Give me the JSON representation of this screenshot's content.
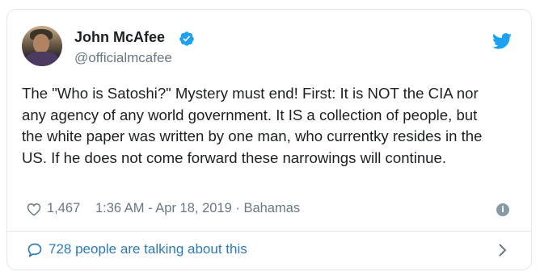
{
  "author": {
    "name": "John McAfee",
    "handle": "@officialmcafee",
    "verified": true
  },
  "tweet": {
    "text": "The \"Who is Satoshi?\" Mystery must end! First: It is NOT the CIA nor any agency of any world government. It IS a collection of people, but the white paper was written by one man, who currentky resides in the US. If he does not come forward these narrowings will continue."
  },
  "meta": {
    "likes": "1,467",
    "timestamp": "1:36 AM - Apr 18, 2019 · Bahamas"
  },
  "footer": {
    "conversation_label": "728 people are talking about this"
  },
  "colors": {
    "twitter_blue": "#1da1f2",
    "link_blue": "#2b7bb9",
    "meta_gray": "#697882",
    "border": "#e1e8ed"
  },
  "icons": {
    "verified": "verified-badge-icon",
    "brand": "twitter-bird-icon",
    "like": "heart-icon",
    "info": "info-icon",
    "conversation": "speech-bubble-icon",
    "expand": "chevron-right-icon"
  }
}
